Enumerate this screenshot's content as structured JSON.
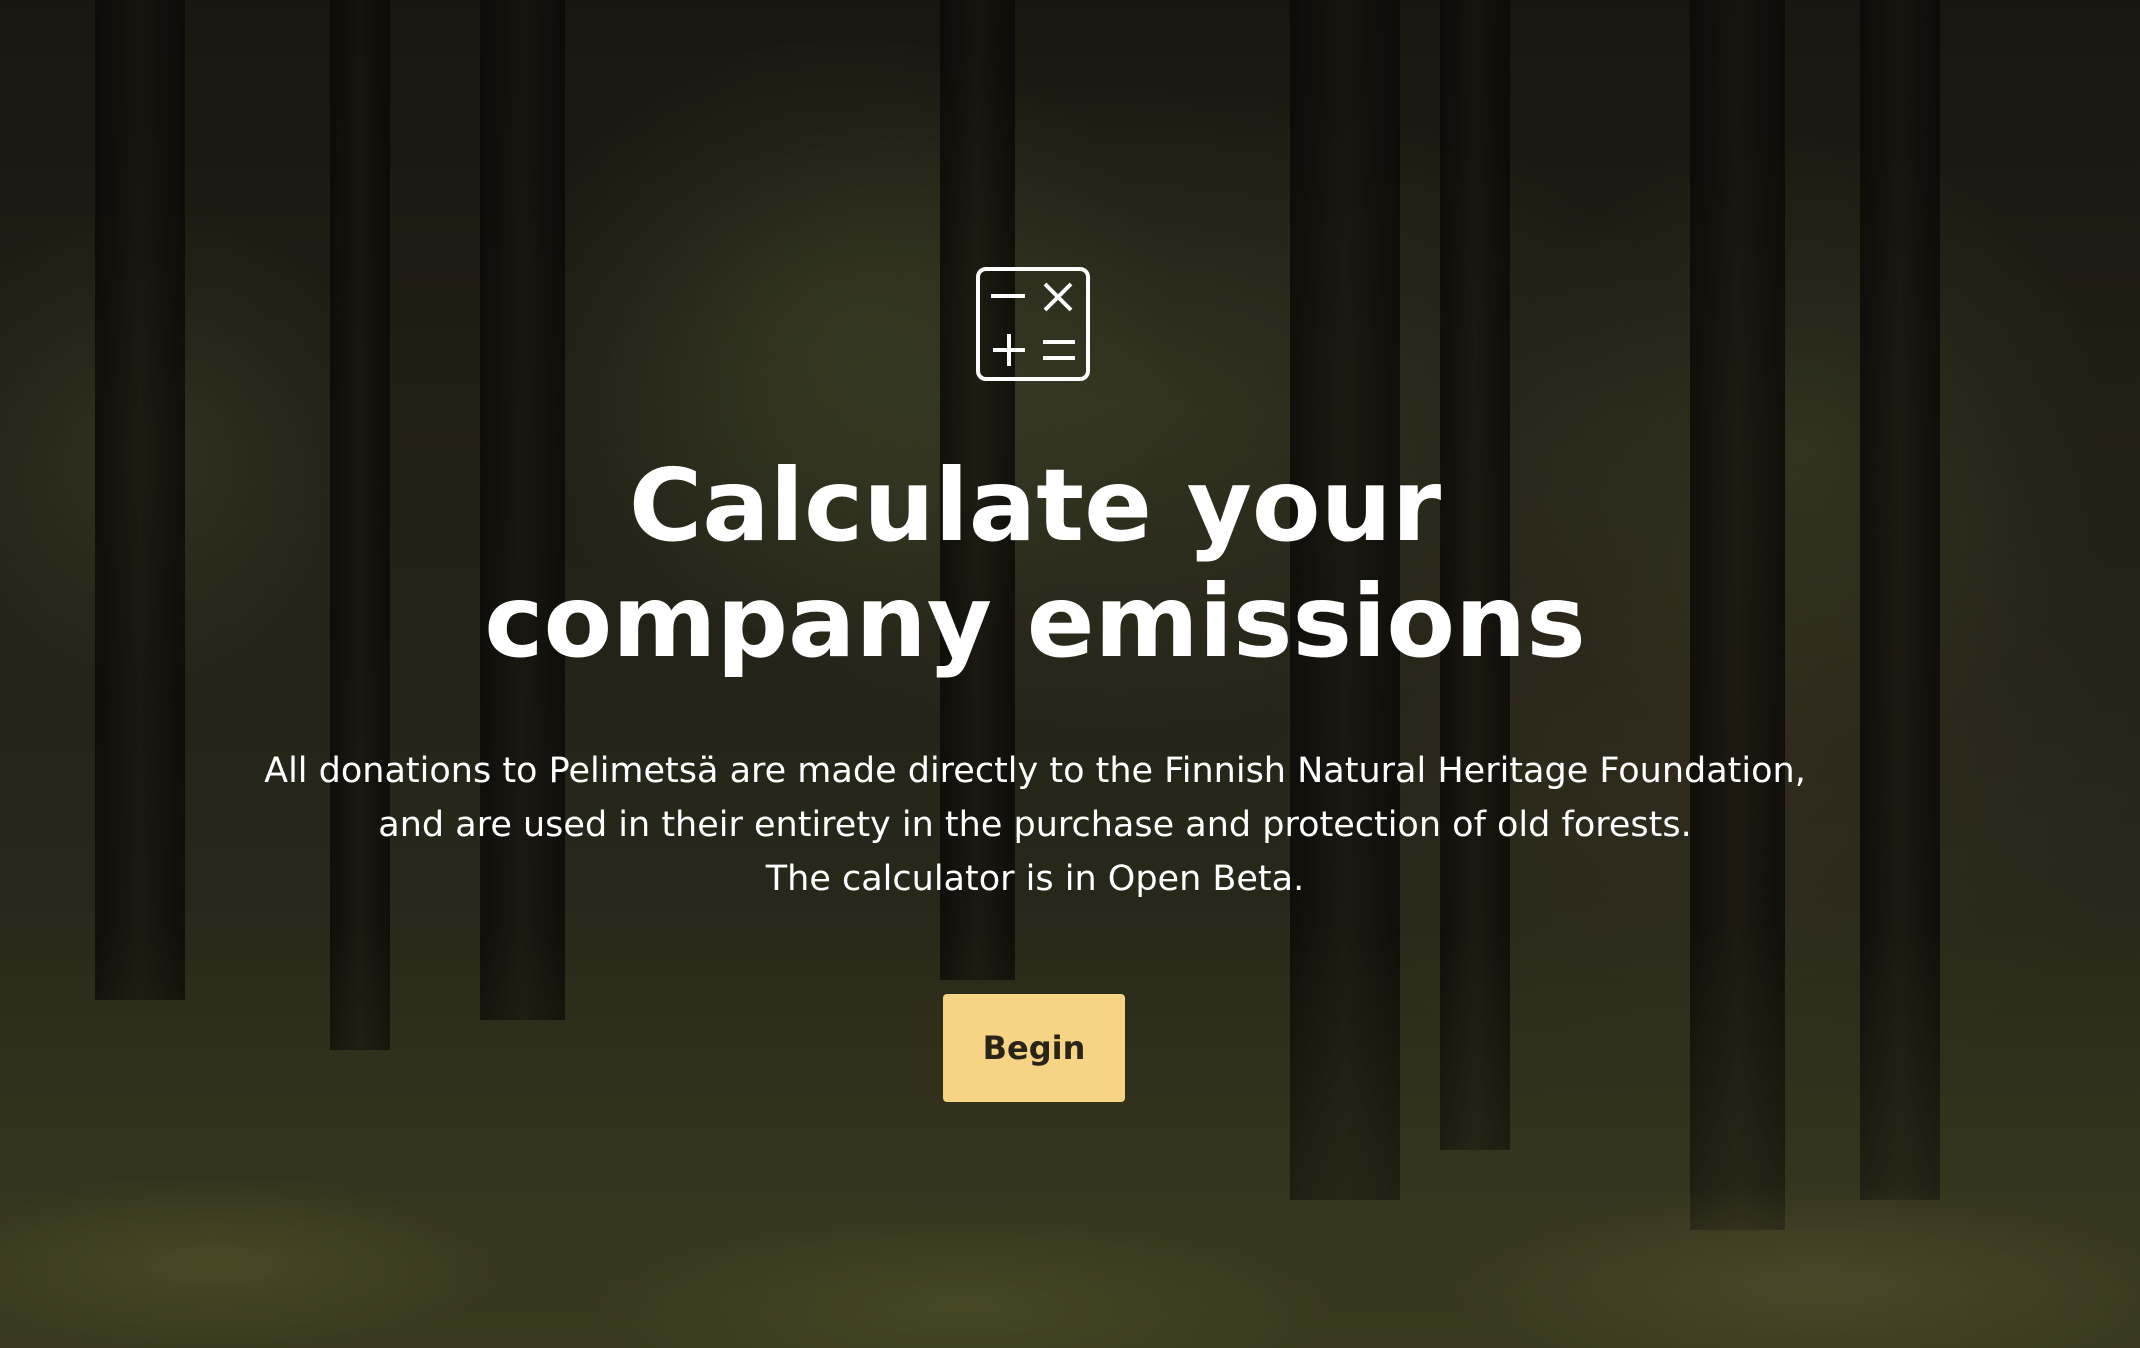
{
  "hero": {
    "icon": "calculator-icon",
    "title": "Calculate your company emissions",
    "description_lines": [
      "All donations to Pelimetsä are made directly to the Finnish Natural Heritage Foundation,",
      "and are used in their entirety in the purchase and protection of old forests.",
      "The calculator is in Open Beta."
    ],
    "begin_label": "Begin"
  },
  "colors": {
    "button_background": "#f7d384",
    "button_text": "#2a2418",
    "text": "#ffffff"
  }
}
